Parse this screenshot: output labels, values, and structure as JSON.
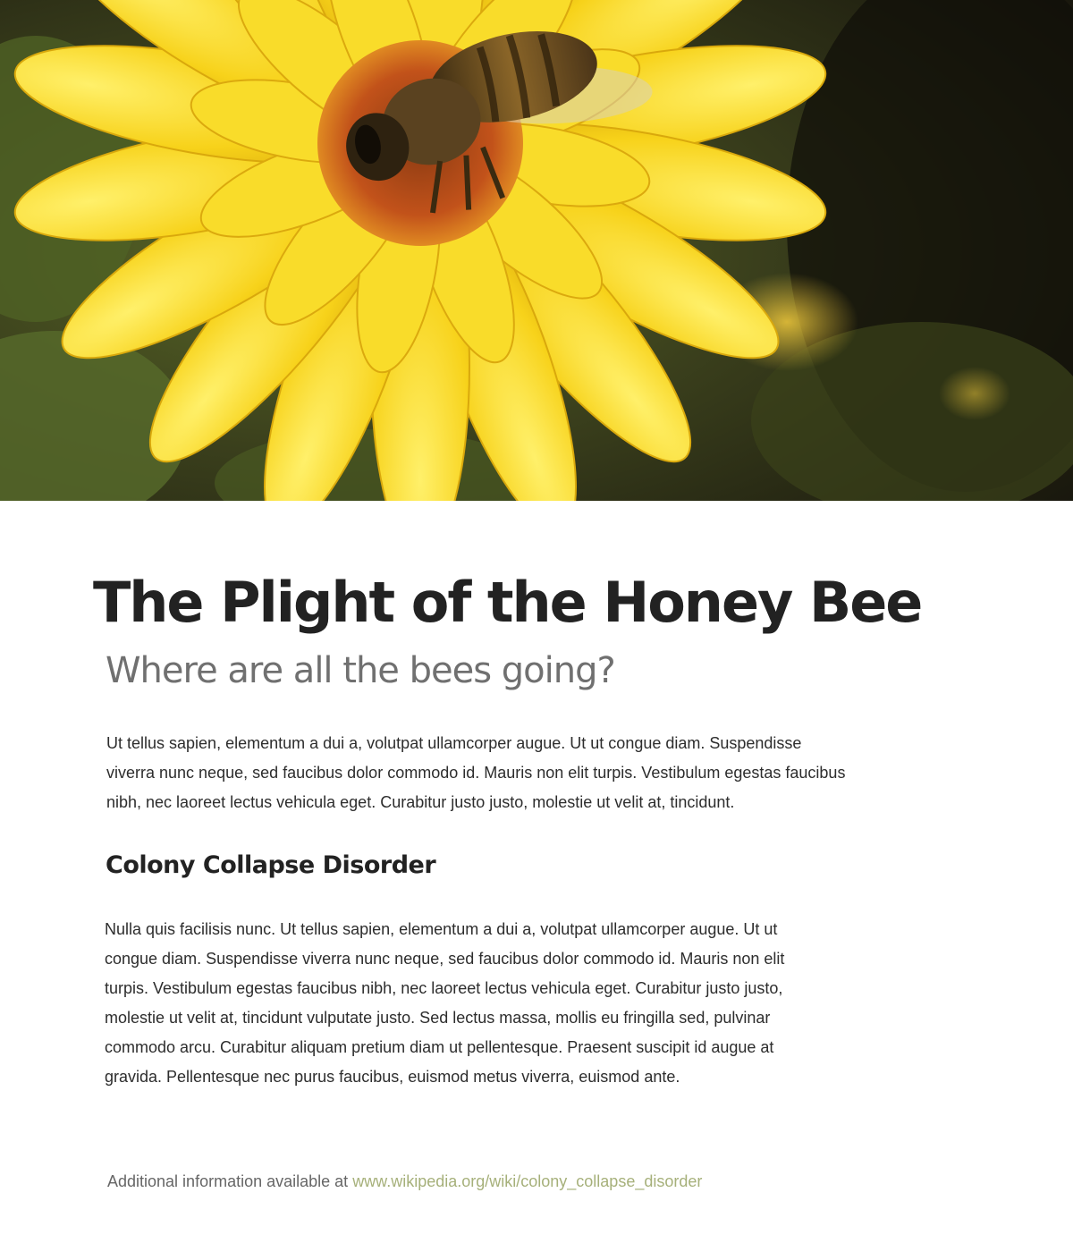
{
  "hero": {
    "image_subject": "honey bee on a yellow flower",
    "colors": {
      "petal": "#f7d21a",
      "petal_shadow": "#d9a80c",
      "center": "#c2521a",
      "background_dark": "#1c1a10",
      "foliage": "#4a5a22"
    }
  },
  "article": {
    "title": "The Plight of the Honey Bee",
    "subtitle": "Where are all the bees going?",
    "intro": "Ut tellus sapien, elementum a dui a, volutpat ullamcorper augue. Ut ut congue diam. Suspendisse viverra nunc neque, sed faucibus dolor commodo id. Mauris non elit turpis. Vestibulum egestas faucibus nibh, nec laoreet lectus vehicula eget. Curabitur justo justo, molestie ut velit at, tincidunt.",
    "section_heading": "Colony Collapse Disorder",
    "body": "Nulla quis facilisis nunc. Ut tellus sapien, elementum a dui a, volutpat ullamcorper augue. Ut ut congue diam. Suspendisse viverra nunc neque, sed faucibus dolor commodo id. Mauris non elit turpis. Vestibulum egestas faucibus nibh, nec laoreet lectus vehicula eget. Curabitur justo justo, molestie ut velit at, tincidunt vulputate justo. Sed lectus massa, mollis eu fringilla sed, pulvinar commodo arcu. Curabitur aliquam pretium diam ut pellentesque. Praesent suscipit id augue at gravida. Pellentesque nec purus faucibus, euismod metus viverra, euismod ante."
  },
  "footer": {
    "prefix": "Additional information available at",
    "link_text": "www.wikipedia.org/wiki/colony_collapse_disorder",
    "link_color": "#a6b07a"
  }
}
